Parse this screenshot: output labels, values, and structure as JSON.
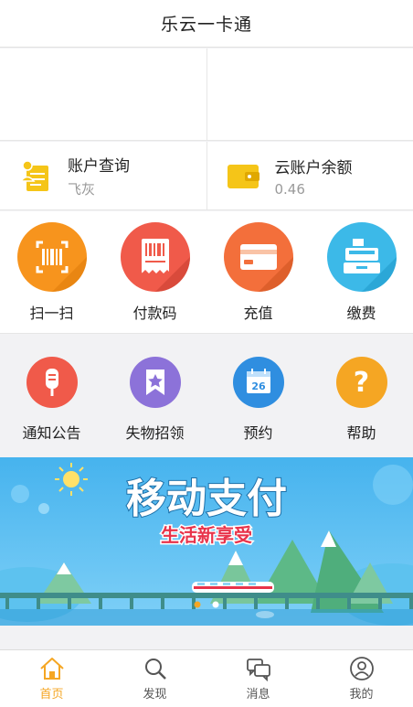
{
  "header": {
    "title": "乐云一卡通"
  },
  "account": {
    "query": {
      "label": "账户查询",
      "value": "飞灰",
      "icon": "account-card-icon",
      "color": "#f5c518"
    },
    "balance": {
      "label": "云账户余额",
      "value": "0.46",
      "icon": "wallet-icon",
      "color": "#f5c518"
    }
  },
  "primary_actions": [
    {
      "label": "扫一扫",
      "icon": "scan-icon",
      "color": "#f7941d"
    },
    {
      "label": "付款码",
      "icon": "barcode-receipt-icon",
      "color": "#f05a4a"
    },
    {
      "label": "充值",
      "icon": "card-icon",
      "color": "#f36f3b"
    },
    {
      "label": "缴费",
      "icon": "cash-register-icon",
      "color": "#3cb9e8"
    }
  ],
  "secondary_actions": [
    {
      "label": "通知公告",
      "icon": "microphone-icon",
      "color": "#f05a4a"
    },
    {
      "label": "失物招领",
      "icon": "star-bookmark-icon",
      "color": "#8c72d9"
    },
    {
      "label": "预约",
      "icon": "calendar-icon",
      "color": "#2f8ee0",
      "day": "26"
    },
    {
      "label": "帮助",
      "icon": "question-icon",
      "color": "#f5a623",
      "glyph": "?"
    }
  ],
  "banner": {
    "title": "移动支付",
    "subtitle": "生活新享受",
    "active_slide": 1,
    "slide_count": 2
  },
  "tabbar": [
    {
      "label": "首页",
      "icon": "home-icon",
      "active": true
    },
    {
      "label": "发现",
      "icon": "search-icon",
      "active": false
    },
    {
      "label": "消息",
      "icon": "message-icon",
      "active": false
    },
    {
      "label": "我的",
      "icon": "user-icon",
      "active": false
    }
  ],
  "colors": {
    "accent": "#f5a623",
    "banner_sky": "#4fb8ee",
    "banner_title": "#ffffff",
    "banner_subtitle": "#e8334a"
  }
}
